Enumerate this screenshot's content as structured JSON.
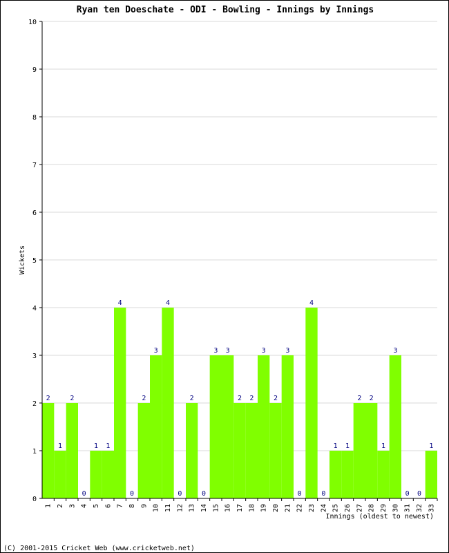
{
  "chart_data": {
    "type": "bar",
    "title": "Ryan ten Doeschate - ODI - Bowling - Innings by Innings",
    "xlabel": "Innings (oldest to newest)",
    "ylabel": "Wickets",
    "ylim": [
      0,
      10
    ],
    "yticks": [
      0,
      1,
      2,
      3,
      4,
      5,
      6,
      7,
      8,
      9,
      10
    ],
    "grid": true,
    "categories": [
      "1",
      "2",
      "3",
      "4",
      "5",
      "6",
      "7",
      "8",
      "9",
      "10",
      "11",
      "12",
      "13",
      "14",
      "15",
      "16",
      "17",
      "18",
      "19",
      "20",
      "21",
      "22",
      "23",
      "24",
      "25",
      "26",
      "27",
      "28",
      "29",
      "30",
      "31",
      "32",
      "33"
    ],
    "values": [
      2,
      1,
      2,
      0,
      1,
      1,
      4,
      0,
      2,
      3,
      4,
      0,
      2,
      0,
      3,
      3,
      2,
      2,
      3,
      2,
      3,
      0,
      4,
      0,
      1,
      1,
      2,
      2,
      1,
      3,
      0,
      0,
      1
    ],
    "bar_color": "#80ff00",
    "label_color": "#000080",
    "grid_color": "#d8d8d8"
  },
  "footer": "(C) 2001-2015 Cricket Web (www.cricketweb.net)"
}
